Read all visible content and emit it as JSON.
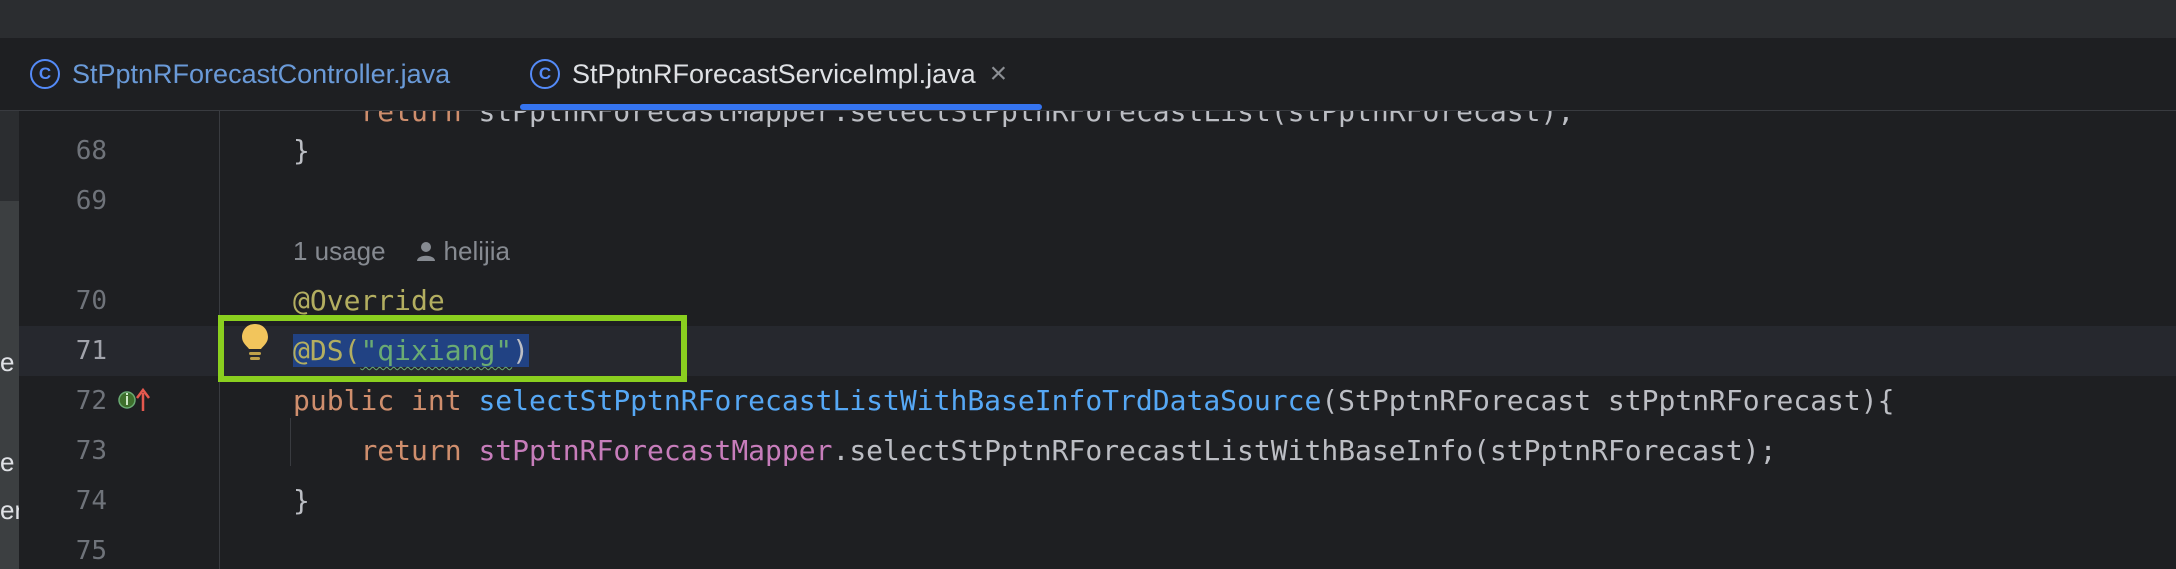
{
  "tabs": [
    {
      "label": "StPptnRForecastController.java",
      "icon": "java-class-icon",
      "active": false
    },
    {
      "label": "StPptnRForecastServiceImpl.java",
      "icon": "java-class-icon",
      "active": true,
      "close": "×"
    }
  ],
  "left_strip": {
    "fragments": [
      "e",
      "e",
      "er"
    ]
  },
  "editor": {
    "partial_line": {
      "indent": "    ",
      "kw": "return",
      "rest": " stPptnRForecastMapper.selectStPptnRForecastList(stPptnRForecast);"
    },
    "line_numbers": [
      "68",
      "69",
      "70",
      "71",
      "72",
      "73",
      "74",
      "75"
    ],
    "lines": {
      "l68": "}",
      "l70": "@Override",
      "l71": {
        "at": "@DS(",
        "str": "\"qixiang\"",
        "close": ")"
      },
      "l72": {
        "kw1": "public",
        "kw2": "int",
        "fn": "selectStPptnRForecastListWithBaseInfoTrdDataSource",
        "params": "(StPptnRForecast stPptnRForecast){"
      },
      "l73": {
        "kw": "return",
        "field": "stPptnRForecastMapper",
        "call": ".selectStPptnRForecastListWithBaseInfo(stPptnRForecast);"
      },
      "l74": "}"
    },
    "inlay": {
      "usage": "1 usage",
      "author": "helijia",
      "author_icon": "person-icon"
    }
  },
  "colors": {
    "highlight_box": "#8acf1f",
    "accent": "#3574f0"
  }
}
